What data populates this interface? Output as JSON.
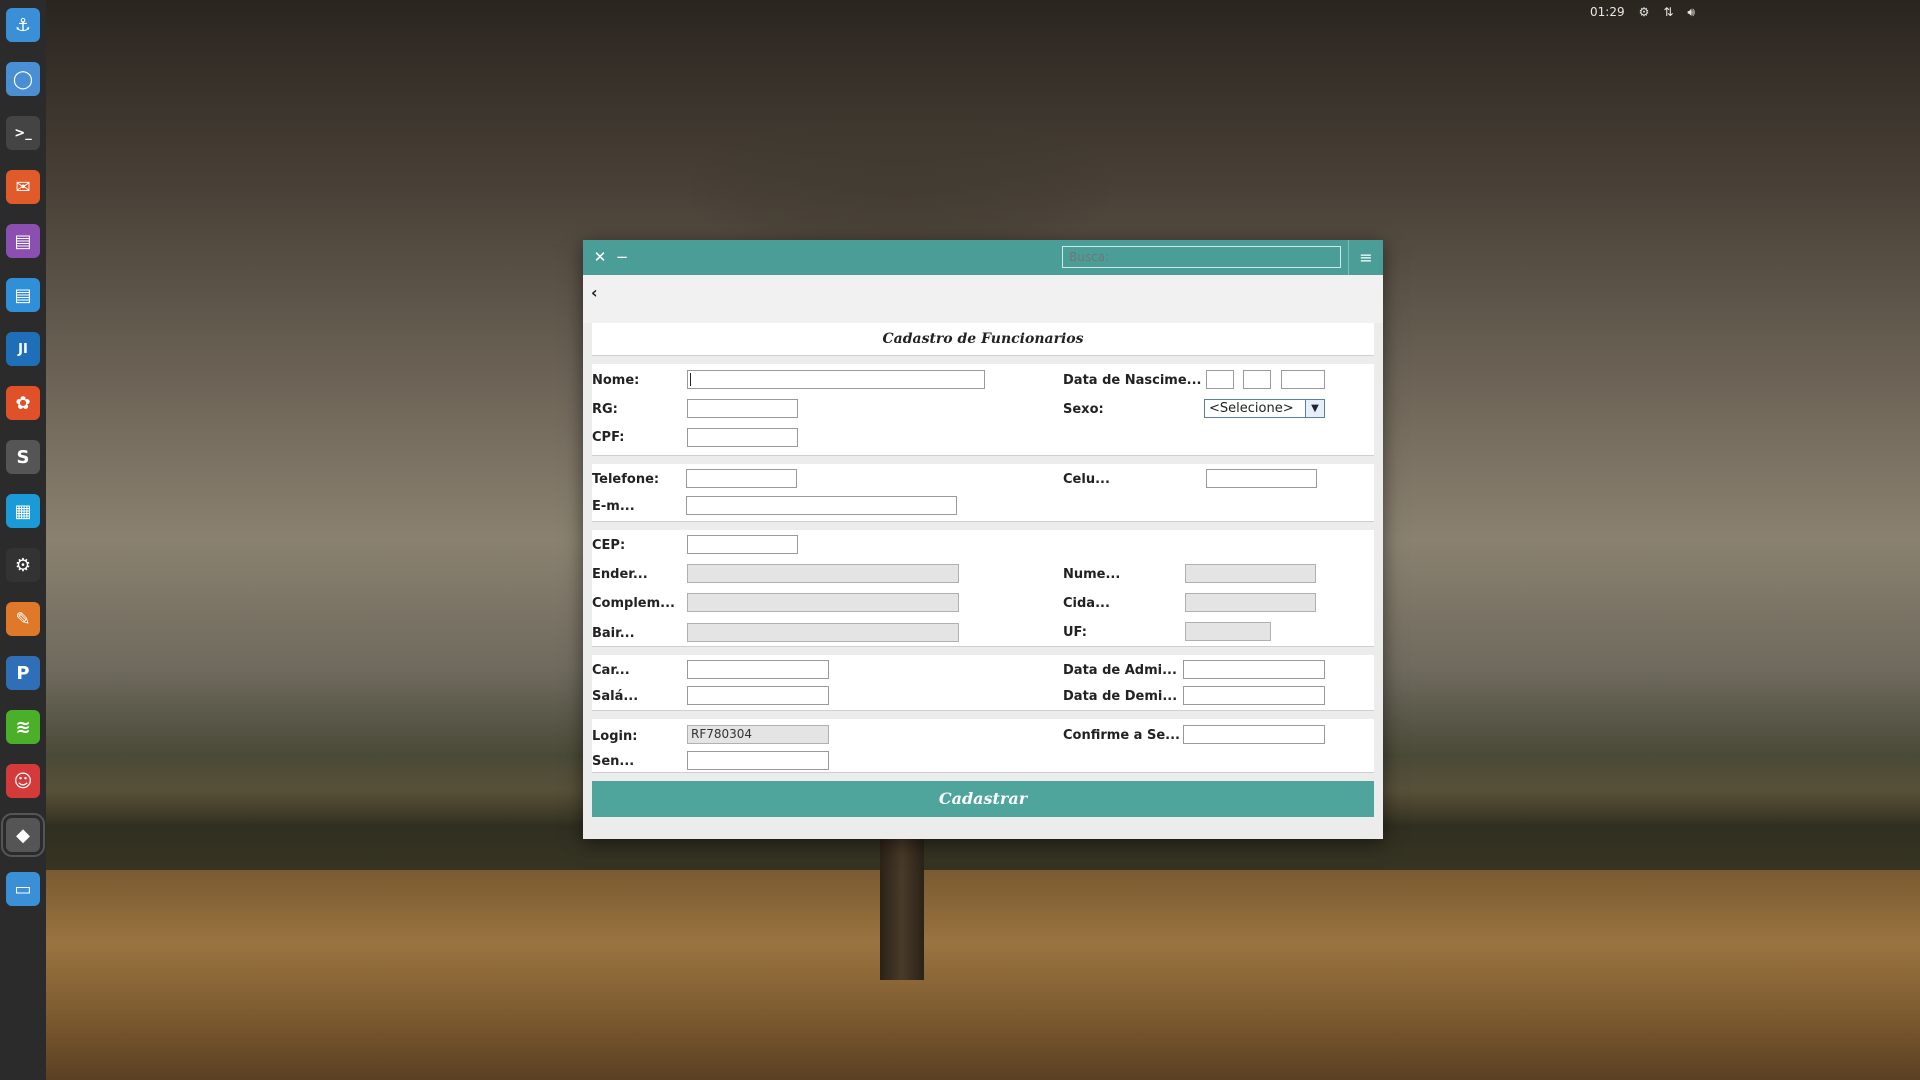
{
  "tray": {
    "time": "01:29",
    "settings_icon": "gear-icon",
    "network_icon": "network-arrows-icon",
    "volume_icon": "volume-icon"
  },
  "dock": [
    {
      "name": "anchor-icon",
      "glyph": "⚓",
      "color": "#3a8fd6"
    },
    {
      "name": "browser-icon",
      "glyph": "◯",
      "color": "#4a8fd4"
    },
    {
      "name": "terminal-icon",
      "glyph": ">_",
      "color": "#444444"
    },
    {
      "name": "mail-icon",
      "glyph": "✉",
      "color": "#e05a2a"
    },
    {
      "name": "document-icon",
      "glyph": "▤",
      "color": "#8a4fb0"
    },
    {
      "name": "notes-icon",
      "glyph": "▤",
      "color": "#2f8fd8"
    },
    {
      "name": "intellij-icon",
      "glyph": "JI",
      "color": "#1f6fb8"
    },
    {
      "name": "xampp-icon",
      "glyph": "✿",
      "color": "#e0512a"
    },
    {
      "name": "sublime-icon",
      "glyph": "S",
      "color": "#555555"
    },
    {
      "name": "monitor-icon",
      "glyph": "▦",
      "color": "#1a9ad6"
    },
    {
      "name": "steam-icon",
      "glyph": "⚙",
      "color": "#333333"
    },
    {
      "name": "gimp-icon",
      "glyph": "✎",
      "color": "#e0782a"
    },
    {
      "name": "pycharm-icon",
      "glyph": "P",
      "color": "#2f6fb8"
    },
    {
      "name": "spotify-icon",
      "glyph": "≋",
      "color": "#4caf2a"
    },
    {
      "name": "game-icon",
      "glyph": "☺",
      "color": "#d43a3a"
    },
    {
      "name": "java-app-icon",
      "glyph": "◆",
      "color": "#555555"
    },
    {
      "name": "window-icon",
      "glyph": "▭",
      "color": "#3a8fd6"
    }
  ],
  "window": {
    "close_label": "✕",
    "minimize_label": "−",
    "search_placeholder": "Busca:",
    "menu_label": "≡",
    "back_label": "‹",
    "form_title": "Cadastro de Funcionarios",
    "submit_label": "Cadastrar"
  },
  "personal": {
    "nome_label": "Nome:",
    "rg_label": "RG:",
    "cpf_label": "CPF:",
    "nascimento_label": "Data de Nascime...",
    "sexo_label": "Sexo:",
    "sexo_value": "<Selecione>"
  },
  "contact": {
    "telefone_label": "Telefone:",
    "celular_label": "Celu...",
    "email_label": "E-m..."
  },
  "address": {
    "cep_label": "CEP:",
    "endereco_label": "Ender...",
    "numero_label": "Nume...",
    "complemento_label": "Complem...",
    "cidade_label": "Cida...",
    "bairro_label": "Bair...",
    "uf_label": "UF:"
  },
  "job": {
    "cargo_label": "Car...",
    "admissao_label": "Data de Admi...",
    "salario_label": "Salá...",
    "demissao_label": "Data de Demi..."
  },
  "account": {
    "login_label": "Login:",
    "login_value": "RF780304",
    "confirme_label": "Confirme a Se...",
    "senha_label": "Sen..."
  }
}
